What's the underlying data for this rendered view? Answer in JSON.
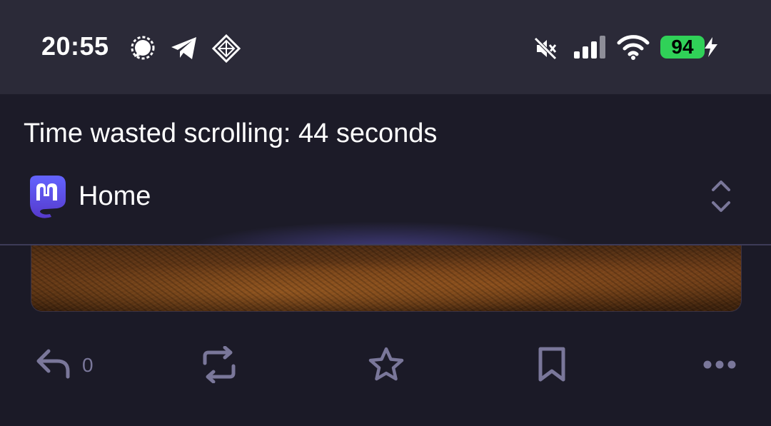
{
  "status_bar": {
    "time": "20:55",
    "battery_percent": "94",
    "battery_color": "#30d158",
    "icons": [
      "signal-app-icon",
      "telegram-icon",
      "vpn-icon",
      "muted-icon",
      "cellular-icon",
      "wifi-icon",
      "charging-bolt-icon"
    ]
  },
  "header": {
    "time_wasted": "Time wasted scrolling: 44 seconds",
    "timeline_label": "Home",
    "app_icon": "mastodon-icon",
    "accent_color": "#6364ff"
  },
  "post_actions": {
    "reply_count": "0",
    "icons": [
      "reply-icon",
      "boost-icon",
      "favourite-icon",
      "bookmark-icon",
      "more-icon"
    ],
    "icon_color": "#7a779a"
  }
}
